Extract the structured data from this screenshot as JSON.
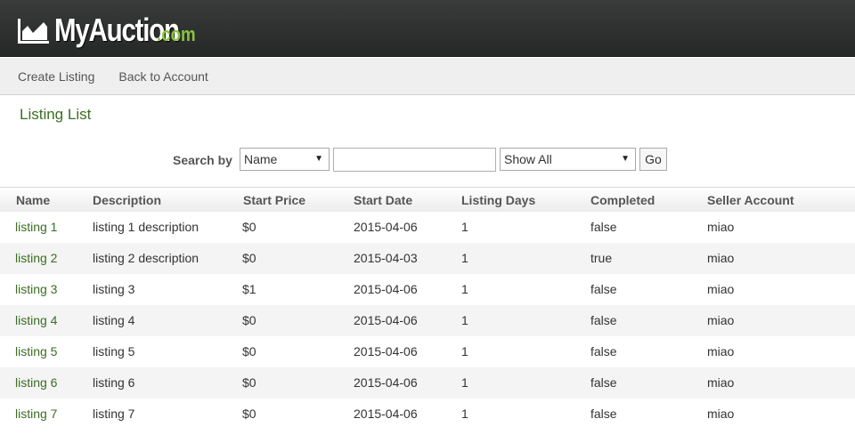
{
  "header": {
    "logo_main": "MyAuction",
    "logo_tld": ".com",
    "logo_icon": "chart-icon"
  },
  "nav": {
    "items": [
      {
        "label": "Create Listing"
      },
      {
        "label": "Back to Account"
      }
    ]
  },
  "page": {
    "title": "Listing List"
  },
  "search": {
    "label": "Search by",
    "field_select": "Name",
    "query_value": "",
    "filter_select": "Show All",
    "go_label": "Go"
  },
  "table": {
    "columns": [
      "Name",
      "Description",
      "Start Price",
      "Start Date",
      "Listing Days",
      "Completed",
      "Seller Account"
    ],
    "rows": [
      {
        "name": "listing 1",
        "description": "listing 1 description",
        "start_price": "$0",
        "start_date": "2015-04-06",
        "listing_days": "1",
        "completed": "false",
        "seller": "miao"
      },
      {
        "name": "listing 2",
        "description": "listing 2 description",
        "start_price": "$0",
        "start_date": "2015-04-03",
        "listing_days": "1",
        "completed": "true",
        "seller": "miao"
      },
      {
        "name": "listing 3",
        "description": "listing 3",
        "start_price": "$1",
        "start_date": "2015-04-06",
        "listing_days": "1",
        "completed": "false",
        "seller": "miao"
      },
      {
        "name": "listing 4",
        "description": "listing 4",
        "start_price": "$0",
        "start_date": "2015-04-06",
        "listing_days": "1",
        "completed": "false",
        "seller": "miao"
      },
      {
        "name": "listing 5",
        "description": "listing 5",
        "start_price": "$0",
        "start_date": "2015-04-06",
        "listing_days": "1",
        "completed": "false",
        "seller": "miao"
      },
      {
        "name": "listing 6",
        "description": "listing 6",
        "start_price": "$0",
        "start_date": "2015-04-06",
        "listing_days": "1",
        "completed": "false",
        "seller": "miao"
      },
      {
        "name": "listing 7",
        "description": "listing 7",
        "start_price": "$0",
        "start_date": "2015-04-06",
        "listing_days": "1",
        "completed": "false",
        "seller": "miao"
      }
    ]
  },
  "colors": {
    "header_bg": "#2e2f2f",
    "brand_green": "#8ac43f",
    "link_green": "#3b6e22",
    "nav_bg": "#efefef"
  }
}
